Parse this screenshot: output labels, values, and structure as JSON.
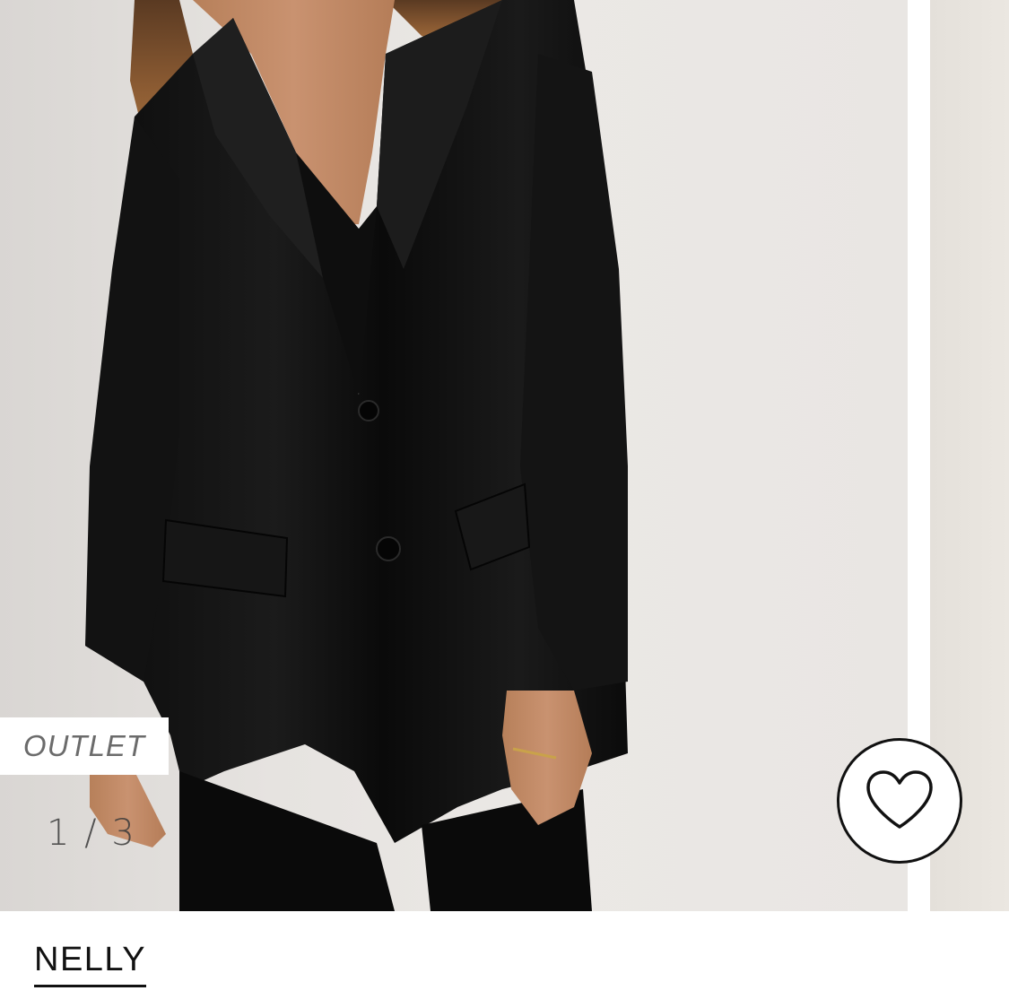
{
  "product": {
    "badge": "OUTLET",
    "brand": "NELLY",
    "image_alt": "Model wearing black satin oversized blazer"
  },
  "carousel": {
    "current": 1,
    "total": 3,
    "counter_text": "1 / 3"
  },
  "icons": {
    "favourite": "heart-outline-icon"
  },
  "colors": {
    "text_primary": "#111111",
    "badge_text": "#6b6b6b",
    "background": "#ffffff"
  }
}
